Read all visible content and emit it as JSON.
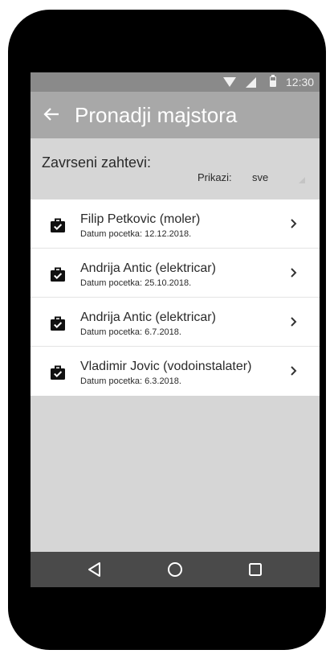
{
  "status_bar": {
    "time": "12:30",
    "icons": [
      "wifi-icon",
      "signal-icon",
      "battery-icon"
    ]
  },
  "app_bar": {
    "title": "Pronadji majstora",
    "back_icon": "back-arrow-icon"
  },
  "filter": {
    "section_label": "Zavrseni zahtevi:",
    "label": "Prikazi:",
    "value": "sve"
  },
  "requests": [
    {
      "title": "Filip Petkovic (moler)",
      "subtitle": "Datum pocetka: 12.12.2018.",
      "icon": "briefcase-check-icon"
    },
    {
      "title": "Andrija Antic (elektricar)",
      "subtitle": "Datum pocetka: 25.10.2018.",
      "icon": "briefcase-check-icon"
    },
    {
      "title": "Andrija Antic (elektricar)",
      "subtitle": "Datum pocetka: 6.7.2018.",
      "icon": "briefcase-check-icon"
    },
    {
      "title": "Vladimir Jovic (vodoinstalater)",
      "subtitle": "Datum pocetka: 6.3.2018.",
      "icon": "briefcase-check-icon"
    }
  ],
  "nav_bar": {
    "buttons": [
      "back-triangle-icon",
      "home-circle-icon",
      "recents-square-icon"
    ]
  },
  "colors": {
    "status_bar": "#8a8a8a",
    "app_bar": "#a8a8a8",
    "background": "#d6d6d6",
    "nav_bar": "#4a4a4a",
    "list_background": "#ffffff",
    "text": "#2a2a2a"
  }
}
